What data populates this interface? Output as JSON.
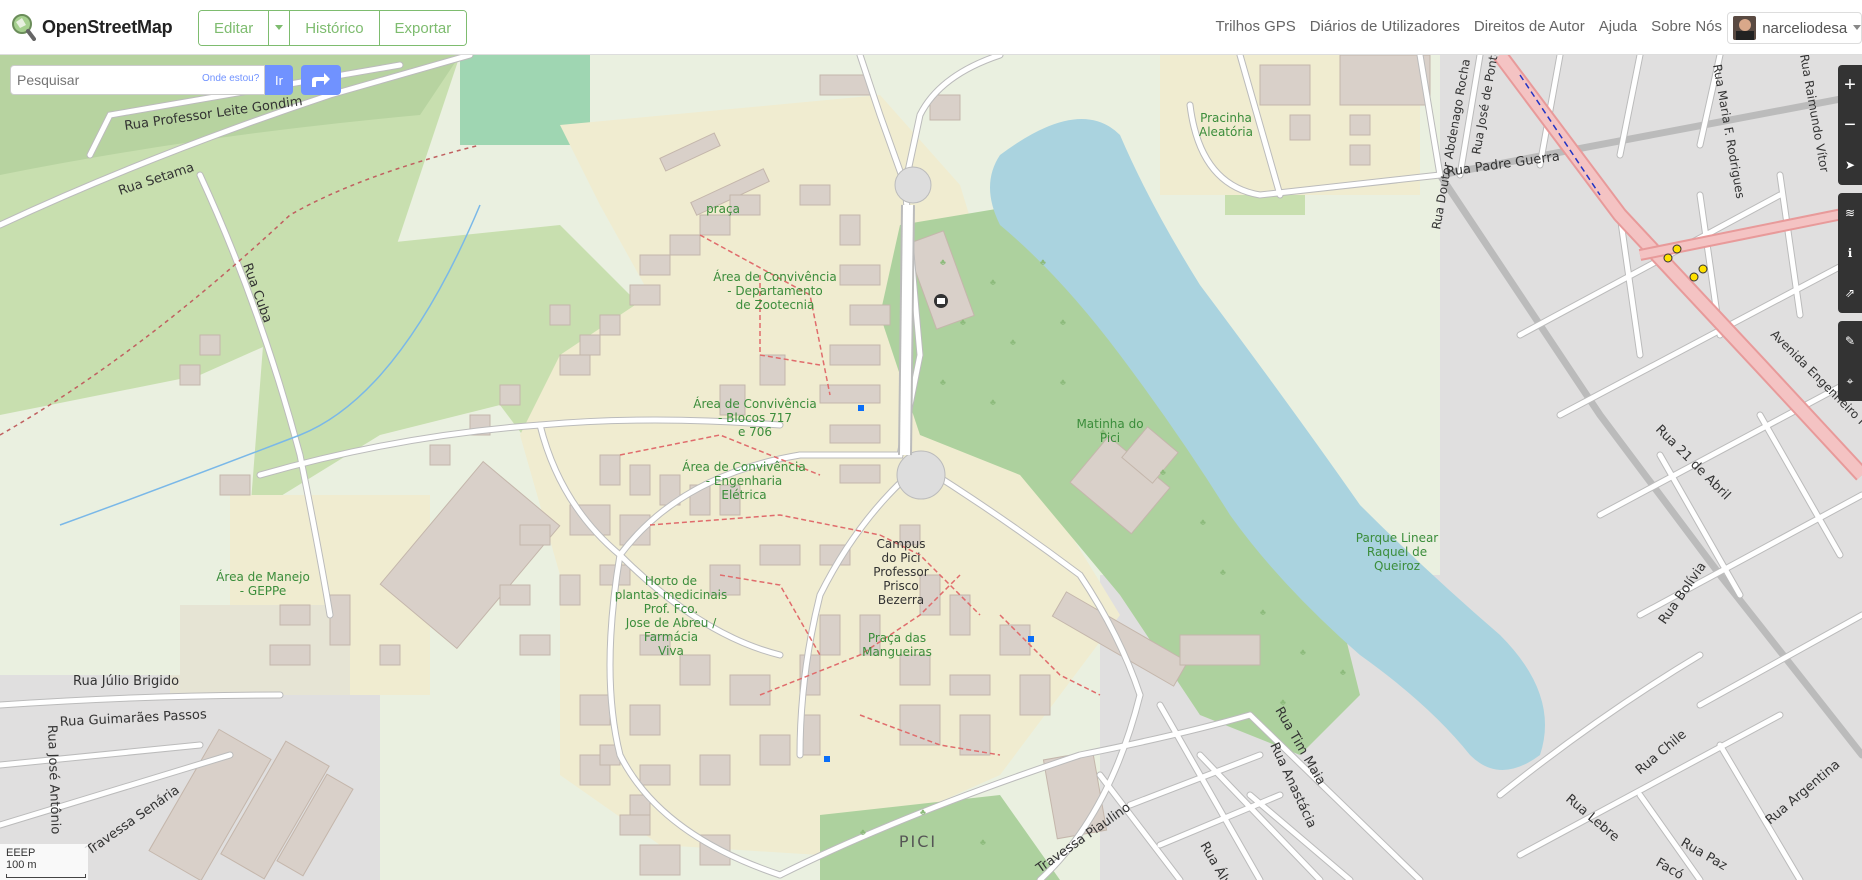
{
  "header": {
    "logo_text": "OpenStreetMap",
    "edit_label": "Editar",
    "history_label": "Histórico",
    "export_label": "Exportar",
    "nav": [
      "Trilhos GPS",
      "Diários de Utilizadores",
      "Direitos de Autor",
      "Ajuda",
      "Sobre Nós"
    ],
    "username": "narceliodesa"
  },
  "search": {
    "placeholder": "Pesquisar",
    "where_am_i": "Onde estou?",
    "go_label": "Ir"
  },
  "controls": [
    "zoom-in",
    "zoom-out",
    "locate",
    "layers",
    "info",
    "share",
    "note",
    "query"
  ],
  "scale": {
    "label_top": "EEEP",
    "label": "100 m"
  },
  "map_labels": {
    "praca": "praça",
    "convivencia_zootecnia": [
      "Área de Convivência",
      "- Departamento",
      "de Zootecnia"
    ],
    "convivencia_blocos": [
      "Área de Convivência",
      "- Blocos 717",
      "e 706"
    ],
    "convivencia_eletrica": [
      "Área de Convivência",
      "- Engenharia",
      "Elétrica"
    ],
    "matinha": [
      "Matinha do",
      "Pici"
    ],
    "parque": [
      "Parque Linear",
      "Raquel de",
      "Queiroz"
    ],
    "campus": [
      "Campus",
      "do Pici",
      "Professor",
      "Prisco",
      "Bezerra"
    ],
    "horto": [
      "Horto de",
      "plantas medicinais",
      "Prof. Fco.",
      "Jose de Abreu /",
      "Farmácia",
      "Viva"
    ],
    "praca_mangueiras": [
      "Praça das",
      "Mangueiras"
    ],
    "area_manejo": [
      "Área de Manejo",
      "- GEPPe"
    ],
    "pracinha": [
      "Pracinha",
      "Aleatória"
    ],
    "pici": "PICI",
    "streets": {
      "leite": "Rua Professor Leite Gondim",
      "setama": "Rua Setama",
      "cuba": "Rua Cuba",
      "julio": "Rua Júlio Brigido",
      "guimaraes": "Rua Guimarães Passos",
      "jose_antonio": "Rua José Antônio",
      "senaria": "Travessa Senária",
      "piaulino": "Travessa Piaulino",
      "tim_maia": "Rua Tim Maia",
      "anastacia": "Rua Anastácia",
      "padre_guerra": "Rua Padre Guerra",
      "abenago": "Rua Doutor Abdenago Rocha",
      "jose_de_ponte": "Rua José de Ponte",
      "maria_rodrigues": "Rua Maria F. Rodrigues",
      "raimundo": "Rua Raimundo Vítor",
      "engenheiro": "Avenida Engenheiro Humberto",
      "abril": "Rua 21 de Abril",
      "bolivia": "Rua Bolívia",
      "chile": "Rua Chile",
      "lebre": "Rua Lebre",
      "argentina": "Rua Argentina",
      "alvaro": "Rua Álva",
      "paz": "Rua Paz",
      "faco": "Facó"
    }
  },
  "colors": {
    "water": "#aad3df",
    "park": "#c8dfaf",
    "forest": "#add19e",
    "building": "#d9d0c9",
    "campus": "#f0ecd0",
    "road": "#ffffff",
    "trunk": "#f9b29c",
    "accent": "#7ebc6f",
    "search_blue": "#7092ff"
  }
}
